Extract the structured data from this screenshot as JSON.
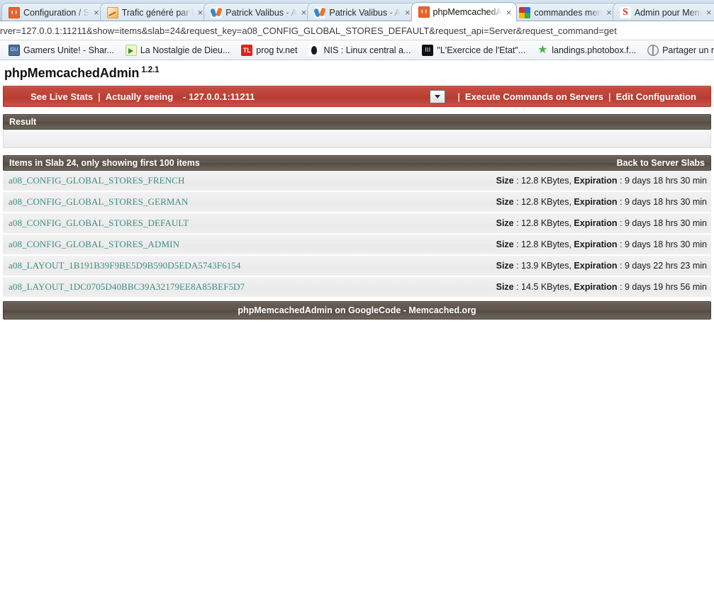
{
  "browser": {
    "tabs": [
      {
        "title": "Configuration / S",
        "favicon": "magento-icon",
        "active": false
      },
      {
        "title": "Trafic généré par l",
        "favicon": "analytics-chart-icon",
        "active": false
      },
      {
        "title": "Patrick Valibus - A",
        "favicon": "joomla-icon",
        "active": false
      },
      {
        "title": "Patrick Valibus - A",
        "favicon": "joomla-icon",
        "active": false
      },
      {
        "title": "phpMemcachedA",
        "favicon": "magento-icon",
        "active": true
      },
      {
        "title": "commandes men",
        "favicon": "google-icon",
        "active": false
      },
      {
        "title": "Admin pour Mem",
        "favicon": "admin-icon",
        "active": false
      }
    ],
    "tab_close_label": "×",
    "url": "rver=127.0.0.1:11211&show=items&slab=24&request_key=a08_CONFIG_GLOBAL_STORES_DEFAULT&request_api=Server&request_command=get",
    "bookmarks": [
      {
        "label": "Gamers Unite! - Shar...",
        "icon": "gamers-unite-icon"
      },
      {
        "label": "La Nostalgie de Dieu...",
        "icon": "nostalgie-icon"
      },
      {
        "label": "prog tv.net",
        "icon": "progtv-icon"
      },
      {
        "label": "NIS : Linux central a...",
        "icon": "linux-penguin-icon"
      },
      {
        "label": "\"L'Exercice de l'Etat\"...",
        "icon": "exercice-etat-icon"
      },
      {
        "label": "landings.photobox.f...",
        "icon": "photobox-star-icon"
      },
      {
        "label": "Partager un répertoi...",
        "icon": "globe-icon"
      },
      {
        "label": "",
        "icon": "globe-icon"
      }
    ]
  },
  "app": {
    "name": "phpMemcachedAdmin",
    "version": "1.2.1",
    "menu": {
      "live_stats": "See Live Stats",
      "separator": "|",
      "actually_seeing": "Actually seeing",
      "current_server": "- 127.0.0.1:11211",
      "server_select_options": [
        "127.0.0.1:11211"
      ],
      "execute_commands": "Execute Commands on Servers",
      "edit_configuration": "Edit Configuration"
    },
    "result": {
      "title": "Result",
      "content": ""
    },
    "items_section": {
      "title": "Items in Slab 24, only showing first 100 items",
      "back_link": "Back to Server Slabs",
      "rows": [
        {
          "key": "a08_CONFIG_GLOBAL_STORES_FRENCH",
          "meta": "Size : 12.8 KBytes, Expiration : 9 days 18 hrs 30 min",
          "size_label": "Size",
          "size": "12.8 KBytes",
          "expiration_label": "Expiration",
          "expiration": "9 days 18 hrs 30 min"
        },
        {
          "key": "a08_CONFIG_GLOBAL_STORES_GERMAN",
          "meta": "Size : 12.8 KBytes, Expiration : 9 days 18 hrs 30 min",
          "size_label": "Size",
          "size": "12.8 KBytes",
          "expiration_label": "Expiration",
          "expiration": "9 days 18 hrs 30 min"
        },
        {
          "key": "a08_CONFIG_GLOBAL_STORES_DEFAULT",
          "meta": "Size : 12.8 KBytes, Expiration : 9 days 18 hrs 30 min",
          "size_label": "Size",
          "size": "12.8 KBytes",
          "expiration_label": "Expiration",
          "expiration": "9 days 18 hrs 30 min"
        },
        {
          "key": "a08_CONFIG_GLOBAL_STORES_ADMIN",
          "meta": "Size : 12.8 KBytes, Expiration : 9 days 18 hrs 30 min",
          "size_label": "Size",
          "size": "12.8 KBytes",
          "expiration_label": "Expiration",
          "expiration": "9 days 18 hrs 30 min"
        },
        {
          "key": "a08_LAYOUT_1B191B39F9BE5D9B590D5EDA5743F6154",
          "meta": "Size : 13.9 KBytes, Expiration : 9 days 22 hrs 23 min",
          "size_label": "Size",
          "size": "13.9 KBytes",
          "expiration_label": "Expiration",
          "expiration": "9 days 22 hrs 23 min"
        },
        {
          "key": "a08_LAYOUT_1DC0705D40BBC39A32179EE8A85BEF5D7",
          "meta": "Size : 14.5 KBytes, Expiration : 9 days 19 hrs 56 min",
          "size_label": "Size",
          "size": "14.5 KBytes",
          "expiration_label": "Expiration",
          "expiration": "9 days 19 hrs 56 min"
        }
      ]
    },
    "footer": {
      "text": "phpMemcachedAdmin on GoogleCode - Memcached.org"
    }
  },
  "colors": {
    "menu_red": "#bd4237",
    "section_brown": "#5d544c",
    "link_teal": "#3f8f85"
  }
}
